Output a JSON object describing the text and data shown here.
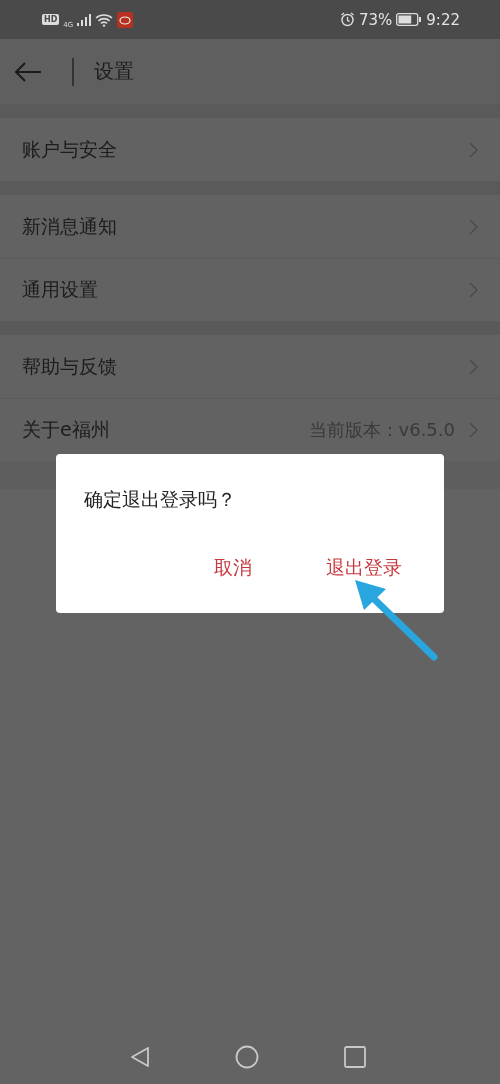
{
  "status_bar": {
    "hd": "HD",
    "network": "4G",
    "battery": "73%",
    "time": "9:22"
  },
  "header": {
    "title": "设置"
  },
  "sections": [
    {
      "items": [
        {
          "label": "账户与安全"
        }
      ]
    },
    {
      "items": [
        {
          "label": "新消息通知"
        },
        {
          "label": "通用设置"
        }
      ]
    },
    {
      "items": [
        {
          "label": "帮助与反馈"
        },
        {
          "label": "关于e福州",
          "value": "当前版本：v6.5.0"
        }
      ]
    }
  ],
  "dialog": {
    "message": "确定退出登录吗？",
    "buttons": [
      {
        "label": "取消"
      },
      {
        "label": "退出登录"
      }
    ]
  }
}
